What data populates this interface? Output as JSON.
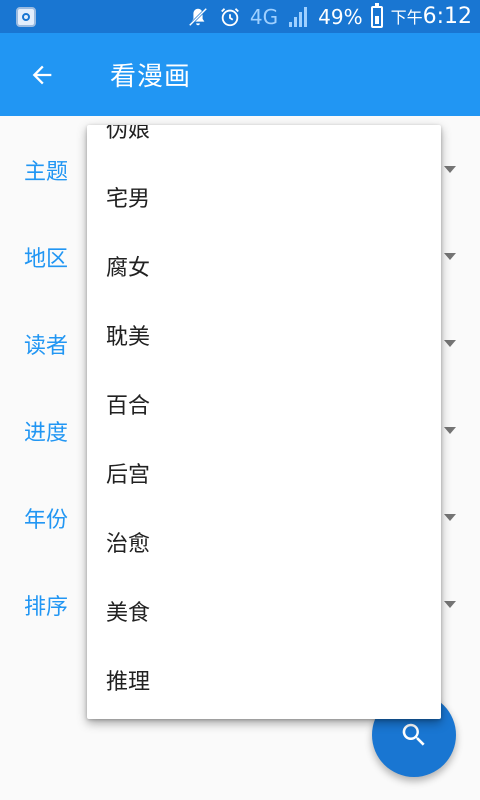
{
  "status_bar": {
    "network": "4G",
    "battery": "49%",
    "time_prefix": "下午",
    "time": "6:12"
  },
  "app_bar": {
    "title": "看漫画",
    "back_icon": "arrow-left-icon"
  },
  "form": {
    "rows": [
      {
        "label": "主题"
      },
      {
        "label": "地区"
      },
      {
        "label": "读者"
      },
      {
        "label": "进度"
      },
      {
        "label": "年份"
      },
      {
        "label": "排序"
      }
    ]
  },
  "dropdown": {
    "options": [
      "伪娘",
      "宅男",
      "腐女",
      "耽美",
      "百合",
      "后宫",
      "治愈",
      "美食",
      "推理"
    ]
  },
  "fab": {
    "icon": "search-icon"
  },
  "colors": {
    "primary": "#2196f3",
    "primary_dark": "#1976d2",
    "text": "#212121"
  }
}
